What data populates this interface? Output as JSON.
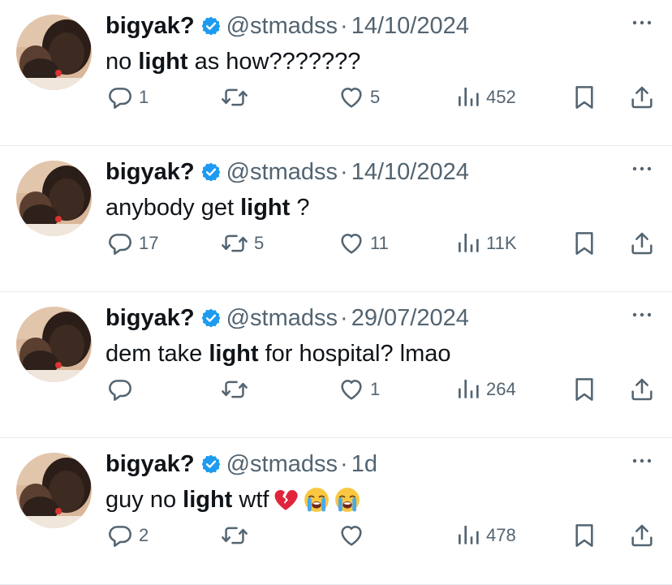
{
  "tweets": [
    {
      "name": "bigyak?",
      "handle": "@stmadss",
      "separator": "·",
      "date": "14/10/2024",
      "text_before": "no ",
      "text_bold": "light",
      "text_after": " as how???????",
      "emojis": [],
      "replies": "1",
      "retweets": "",
      "likes": "5",
      "views": "452"
    },
    {
      "name": "bigyak?",
      "handle": "@stmadss",
      "separator": "·",
      "date": "14/10/2024",
      "text_before": "anybody get ",
      "text_bold": "light",
      "text_after": " ?",
      "emojis": [],
      "replies": "17",
      "retweets": "5",
      "likes": "11",
      "views": "11K"
    },
    {
      "name": "bigyak?",
      "handle": "@stmadss",
      "separator": "·",
      "date": "29/07/2024",
      "text_before": "dem take ",
      "text_bold": "light",
      "text_after": " for hospital? lmao",
      "emojis": [],
      "replies": "",
      "retweets": "",
      "likes": "1",
      "views": "264"
    },
    {
      "name": "bigyak?",
      "handle": "@stmadss",
      "separator": "·",
      "date": "1d",
      "text_before": "guy no ",
      "text_bold": "light",
      "text_after": " wtf",
      "emojis": [
        "broken-heart",
        "loudly-crying-face",
        "loudly-crying-face"
      ],
      "replies": "2",
      "retweets": "",
      "likes": "",
      "views": "478"
    }
  ],
  "icons": {
    "verified": "verified-badge-icon",
    "more": "more-options-icon",
    "reply": "reply-icon",
    "retweet": "retweet-icon",
    "like": "like-icon",
    "views": "views-icon",
    "bookmark": "bookmark-icon",
    "share": "share-icon"
  },
  "colors": {
    "text": "#0f1419",
    "secondary": "#536471",
    "verified": "#1d9bf0",
    "divider": "#e6e9ec",
    "broken_heart": "#e0243b",
    "emoji_yellow": "#f9c740"
  }
}
